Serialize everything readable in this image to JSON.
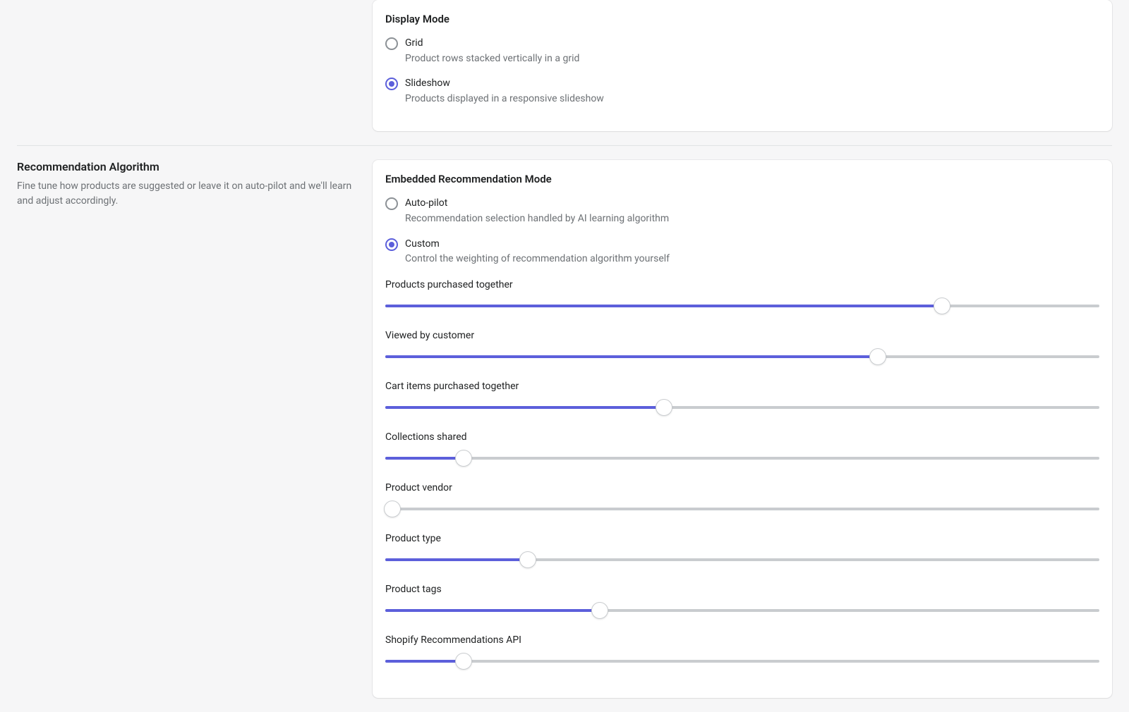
{
  "display_mode": {
    "title": "Display Mode",
    "options": [
      {
        "label": "Grid",
        "desc": "Product rows stacked vertically in a grid",
        "selected": false
      },
      {
        "label": "Slideshow",
        "desc": "Products displayed in a responsive slideshow",
        "selected": true
      }
    ]
  },
  "algorithm": {
    "title": "Recommendation Algorithm",
    "desc": "Fine tune how products are suggested or leave it on auto-pilot and we'll learn and adjust accordingly."
  },
  "embedded_mode": {
    "title": "Embedded Recommendation Mode",
    "options": [
      {
        "label": "Auto-pilot",
        "desc": "Recommendation selection handled by AI learning algorithm",
        "selected": false
      },
      {
        "label": "Custom",
        "desc": "Control the weighting of recommendation algorithm yourself",
        "selected": true
      }
    ]
  },
  "sliders": [
    {
      "label": "Products purchased together",
      "value": 78
    },
    {
      "label": "Viewed by customer",
      "value": 69
    },
    {
      "label": "Cart items purchased together",
      "value": 39
    },
    {
      "label": "Collections shared",
      "value": 11
    },
    {
      "label": "Product vendor",
      "value": 1
    },
    {
      "label": "Product type",
      "value": 20
    },
    {
      "label": "Product tags",
      "value": 30
    },
    {
      "label": "Shopify Recommendations API",
      "value": 11
    }
  ],
  "colors": {
    "accent": "#5c5fdb",
    "border": "#e1e3e5",
    "track": "#c9cccf",
    "text_muted": "#6d7175"
  }
}
